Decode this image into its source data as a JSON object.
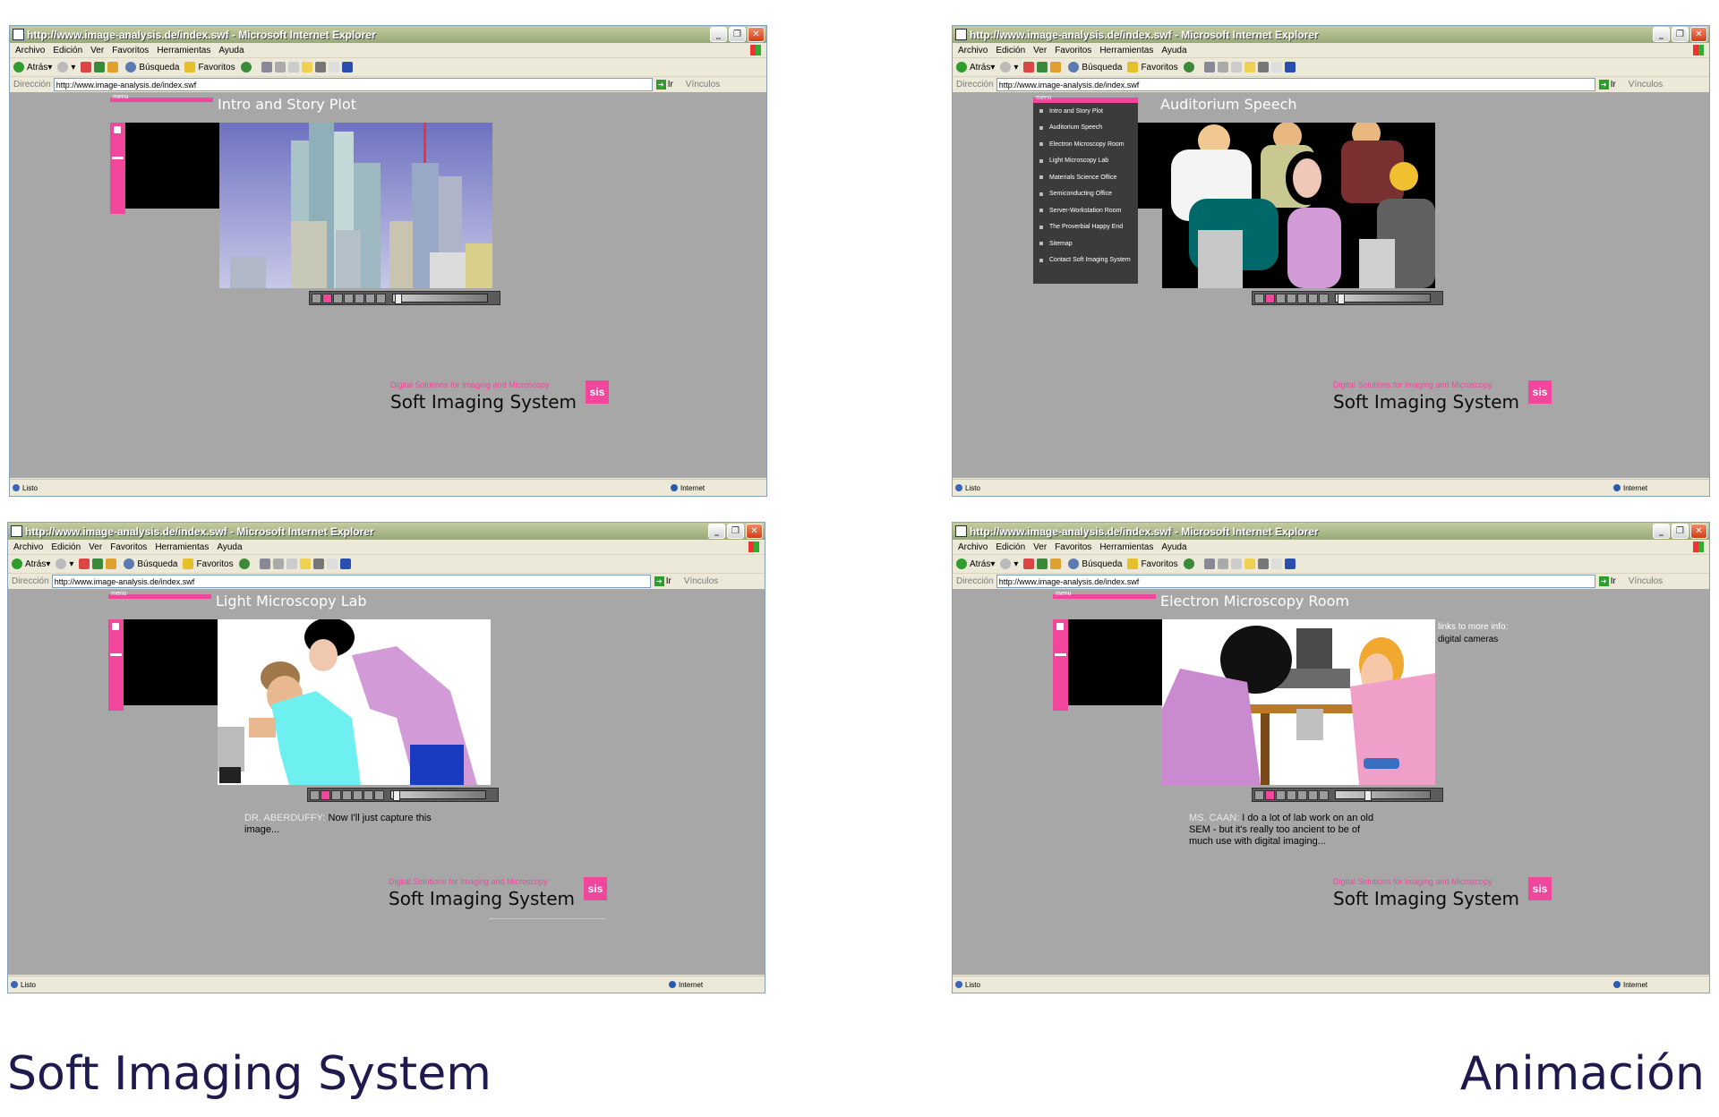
{
  "browser": {
    "title": "http://www.image-analysis.de/index.swf - Microsoft Internet Explorer",
    "menu": [
      "Archivo",
      "Edición",
      "Ver",
      "Favoritos",
      "Herramientas",
      "Ayuda"
    ],
    "toolbar": {
      "back": "Atrás",
      "search": "Búsqueda",
      "favorites": "Favoritos"
    },
    "address_label": "Dirección",
    "address": "http://www.image-analysis.de/index.swf",
    "go": "Ir",
    "links": "Vínculos",
    "status_left": "Listo",
    "status_zone": "Internet"
  },
  "site": {
    "menu_label": "menu",
    "tagline": "Digital Solutions for Imaging and Microscopy",
    "brand_name": "Soft Imaging System",
    "logo_text": "sis"
  },
  "panels": [
    {
      "scene_title": "Intro and Story Plot"
    },
    {
      "scene_title": "Auditorium Speech",
      "menu_items": [
        "Intro and Story Plot",
        "Auditorium Speech",
        "Electron Microscopy Room",
        "Light Microscopy Lab",
        "Materials Science Office",
        "Semiconducting Office",
        "Server-Workstation Room",
        "The Proverbial Happy End",
        "Sitemap",
        "Contact Soft Imaging System"
      ]
    },
    {
      "scene_title": "Light Microscopy Lab",
      "speaker": "DR. ABERDUFFY:",
      "line": "Now I'll just capture this image..."
    },
    {
      "scene_title": "Electron Microscopy Room",
      "speaker": "MS. CAAN:",
      "line": "I do a lot of lab work on an old SEM - but it's really too ancient to be of much use with digital imaging...",
      "links_title": "links to more info:",
      "link": "digital cameras"
    }
  ],
  "captions": {
    "left": "Soft Imaging System",
    "right": "Animación"
  }
}
